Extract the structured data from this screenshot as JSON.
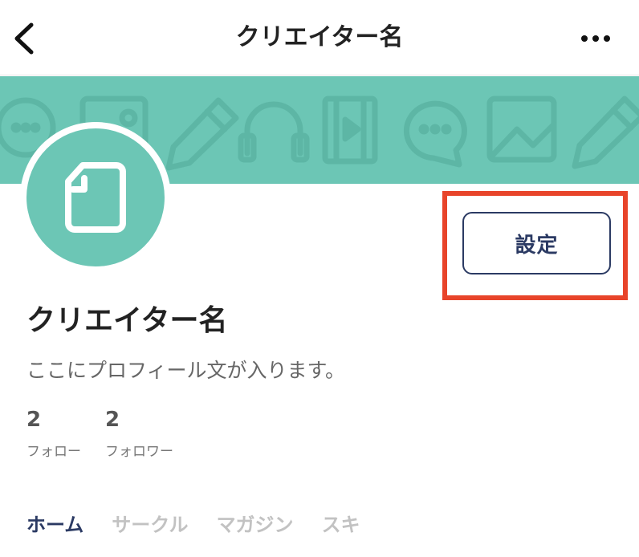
{
  "header": {
    "title": "クリエイター名",
    "back_icon": "chevron-left-icon",
    "more_icon": "more-horizontal-icon"
  },
  "banner": {
    "color": "#6cc6b5",
    "pattern_icons": [
      "chat-bubble-icon",
      "image-icon",
      "pencil-icon",
      "headphones-icon",
      "film-icon",
      "chat-bubble-icon",
      "image-icon",
      "pencil-icon"
    ]
  },
  "avatar": {
    "icon": "note-document-icon",
    "color": "#6cc6b5"
  },
  "settings": {
    "label": "設定",
    "highlight_color": "#e8442a"
  },
  "profile": {
    "name": "クリエイター名",
    "bio": "ここにプロフィール文が入ります。"
  },
  "stats": {
    "follow": {
      "count": "2",
      "label": "フォロー"
    },
    "follower": {
      "count": "2",
      "label": "フォロワー"
    }
  },
  "tabs": [
    {
      "label": "ホーム",
      "active": true
    },
    {
      "label": "サークル",
      "active": false
    },
    {
      "label": "マガジン",
      "active": false
    },
    {
      "label": "スキ",
      "active": false
    }
  ],
  "colors": {
    "accent": "#6cc6b5",
    "navy": "#2b3a63"
  }
}
